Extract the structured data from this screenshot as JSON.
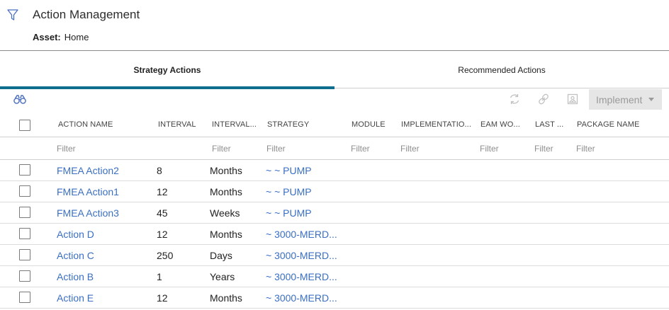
{
  "header": {
    "title": "Action Management",
    "asset_label": "Asset:",
    "asset_value": "Home"
  },
  "tabs": [
    {
      "label": "Strategy Actions",
      "active": true
    },
    {
      "label": "Recommended Actions",
      "active": false
    }
  ],
  "toolbar": {
    "icons": [
      "binoculars-icon",
      "refresh-icon",
      "link-icon",
      "image-icon"
    ],
    "implement_label": "Implement"
  },
  "columns": [
    {
      "label": "ACTION NAME",
      "filter": "Filter"
    },
    {
      "label": "INTERVAL",
      "filter": ""
    },
    {
      "label": "INTERVAL...",
      "filter": "Filter"
    },
    {
      "label": "STRATEGY",
      "filter": "Filter"
    },
    {
      "label": "MODULE",
      "filter": "Filter"
    },
    {
      "label": "IMPLEMENTATIO...",
      "filter": "Filter"
    },
    {
      "label": "EAM WO...",
      "filter": "Filter"
    },
    {
      "label": "LAST ...",
      "filter": "Filter"
    },
    {
      "label": "PACKAGE NAME",
      "filter": "Filter"
    }
  ],
  "rows": [
    {
      "name": "FMEA Action2",
      "interval": "8",
      "unit": "Months",
      "strategy": "~ ~ PUMP"
    },
    {
      "name": "FMEA Action1",
      "interval": "12",
      "unit": "Months",
      "strategy": "~ ~ PUMP"
    },
    {
      "name": "FMEA Action3",
      "interval": "45",
      "unit": "Weeks",
      "strategy": "~ ~ PUMP"
    },
    {
      "name": "Action D",
      "interval": "12",
      "unit": "Months",
      "strategy": "~ 3000-MERD..."
    },
    {
      "name": "Action C",
      "interval": "250",
      "unit": "Days",
      "strategy": "~ 3000-MERD..."
    },
    {
      "name": "Action B",
      "interval": "1",
      "unit": "Years",
      "strategy": "~ 3000-MERD..."
    },
    {
      "name": "Action E",
      "interval": "12",
      "unit": "Months",
      "strategy": "~ 3000-MERD..."
    }
  ],
  "colors": {
    "accent": "#0f6e8d",
    "link": "#3a6fc4",
    "filter_icon": "#4a6fc0"
  }
}
